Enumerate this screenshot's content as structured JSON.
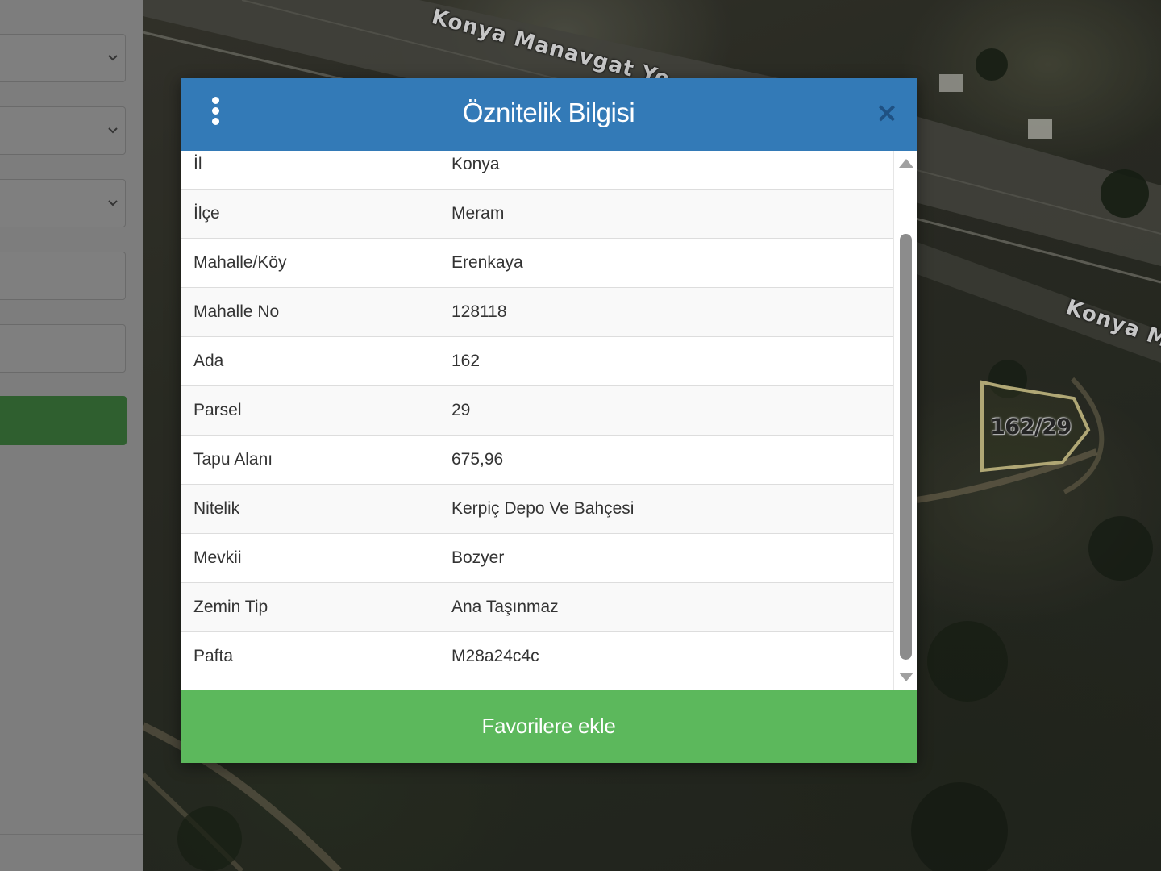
{
  "modal": {
    "title": "Öznitelik Bilgisi",
    "close_symbol": "×",
    "menu_icon": "vertical-ellipsis-icon",
    "rows": [
      {
        "key": "İl",
        "value": "Konya"
      },
      {
        "key": "İlçe",
        "value": "Meram"
      },
      {
        "key": "Mahalle/Köy",
        "value": "Erenkaya"
      },
      {
        "key": "Mahalle No",
        "value": "128118"
      },
      {
        "key": "Ada",
        "value": "162"
      },
      {
        "key": "Parsel",
        "value": "29"
      },
      {
        "key": "Tapu Alanı",
        "value": "675,96"
      },
      {
        "key": "Nitelik",
        "value": "Kerpiç Depo Ve Bahçesi"
      },
      {
        "key": "Mevkii",
        "value": "Bozyer"
      },
      {
        "key": "Zemin Tip",
        "value": "Ana Taşınmaz"
      },
      {
        "key": "Pafta",
        "value": "M28a24c4c"
      }
    ],
    "favorite_button_label": "Favorilere ekle"
  },
  "map": {
    "road_label_top": "Konya Manavgat Yo",
    "road_label_right": "Konya M",
    "parcel_label": "162/29"
  },
  "colors": {
    "header": "#337ab7",
    "favorite_button": "#5cb85c",
    "left_panel_button": "#2f5f2f"
  }
}
